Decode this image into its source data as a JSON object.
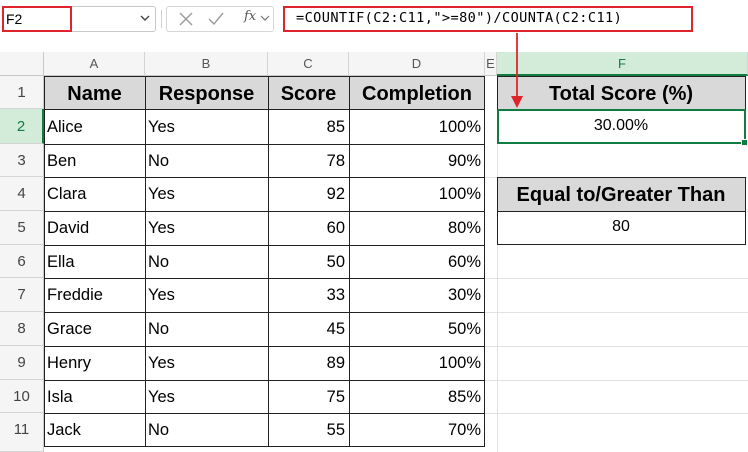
{
  "name_box": {
    "value": "F2"
  },
  "formula_bar": {
    "fx_label": "fx",
    "formula": "=COUNTIF(C2:C11,\">=80\")/COUNTA(C2:C11)"
  },
  "columns": [
    "A",
    "B",
    "C",
    "D",
    "E",
    "F"
  ],
  "rows": [
    "1",
    "2",
    "3",
    "4",
    "5",
    "6",
    "7",
    "8",
    "9",
    "10",
    "11"
  ],
  "table": {
    "headers": [
      "Name",
      "Response",
      "Score",
      "Completion"
    ],
    "records": [
      [
        "Alice",
        "Yes",
        "85",
        "100%"
      ],
      [
        "Ben",
        "No",
        "78",
        "90%"
      ],
      [
        "Clara",
        "Yes",
        "92",
        "100%"
      ],
      [
        "David",
        "Yes",
        "60",
        "80%"
      ],
      [
        "Ella",
        "No",
        "50",
        "60%"
      ],
      [
        "Freddie",
        "Yes",
        "33",
        "30%"
      ],
      [
        "Grace",
        "No",
        "45",
        "50%"
      ],
      [
        "Henry",
        "Yes",
        "89",
        "100%"
      ],
      [
        "Isla",
        "Yes",
        "75",
        "85%"
      ],
      [
        "Jack",
        "No",
        "55",
        "70%"
      ]
    ]
  },
  "result": {
    "header": "Total Score (%)",
    "value": "30.00%"
  },
  "threshold": {
    "header": "Equal to/Greater Than",
    "value": "80"
  },
  "accent_colors": {
    "selection": "#107c41",
    "annotation": "#e0242b",
    "header_fill": "#d9d9d9"
  },
  "icons": [
    "chevron-down-icon",
    "cancel-x-icon",
    "confirm-check-icon",
    "function-fx-icon"
  ]
}
